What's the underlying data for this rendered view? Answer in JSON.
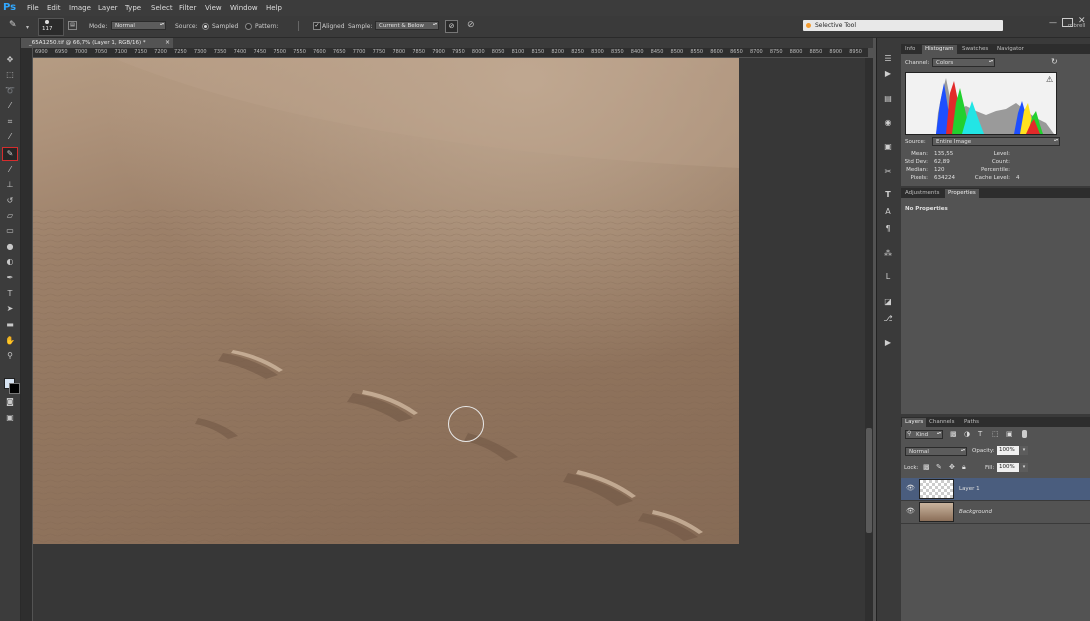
{
  "menu": {
    "logo": "Ps",
    "items": [
      "File",
      "Edit",
      "Image",
      "Layer",
      "Type",
      "Select",
      "Filter",
      "View",
      "Window",
      "Help"
    ]
  },
  "selective_tool": {
    "label": "Selective Tool"
  },
  "window_controls": {
    "right_text": "mbrell"
  },
  "options": {
    "brush_size": "117",
    "mode_label": "Mode:",
    "mode_value": "Normal",
    "source_label": "Source:",
    "sampled_label": "Sampled",
    "pattern_label": "Pattern:",
    "aligned_label": "Aligned",
    "sample_label": "Sample:",
    "sample_value": "Current & Below"
  },
  "document": {
    "tab_title": "_65A1250.tif @ 66,7% (Layer 1, RGB/16) *",
    "close": "×"
  },
  "ruler_top": [
    "6900",
    "6950",
    "7000",
    "7050",
    "7100",
    "7150",
    "7200",
    "7250",
    "7300",
    "7350",
    "7400",
    "7450",
    "7500",
    "7550",
    "7600",
    "7650",
    "7700",
    "7750",
    "7800",
    "7850",
    "7900",
    "7950",
    "8000",
    "8050",
    "8100",
    "8150",
    "8200",
    "8250",
    "8300",
    "8350",
    "8400",
    "8450",
    "8500",
    "8550",
    "8600",
    "8650",
    "8700",
    "8750",
    "8800",
    "8850",
    "8900",
    "8950"
  ],
  "panels": {
    "top_tabs": [
      "Info",
      "Histogram",
      "Swatches",
      "Navigator"
    ],
    "channel_label": "Channel:",
    "channel_value": "Colors",
    "source_label": "Source:",
    "source_value": "Entire Image",
    "stats_left": [
      {
        "label": "Mean:",
        "value": "135,55"
      },
      {
        "label": "Std Dev:",
        "value": "62,89"
      },
      {
        "label": "Median:",
        "value": "120"
      },
      {
        "label": "Pixels:",
        "value": "634224"
      }
    ],
    "stats_right": [
      {
        "label": "Level:",
        "value": ""
      },
      {
        "label": "Count:",
        "value": ""
      },
      {
        "label": "Percentile:",
        "value": ""
      },
      {
        "label": "Cache Level:",
        "value": "4"
      }
    ],
    "mid_tabs": [
      "Adjustments",
      "Properties"
    ],
    "properties_text": "No Properties",
    "layers_tabs": [
      "Layers",
      "Channels",
      "Paths"
    ],
    "kind_label": "Kind",
    "blend_value": "Normal",
    "opacity_label": "Opacity:",
    "opacity_value": "100%",
    "lock_label": "Lock:",
    "fill_label": "Fill:",
    "fill_value": "100%",
    "layers": [
      {
        "name": "Layer 1",
        "selected": true
      },
      {
        "name": "Background",
        "selected": false
      }
    ]
  },
  "colors": {
    "accent": "#31a8ff",
    "active_tool_outline": "#d62d2d",
    "selected_layer": "#4a5d7e"
  }
}
